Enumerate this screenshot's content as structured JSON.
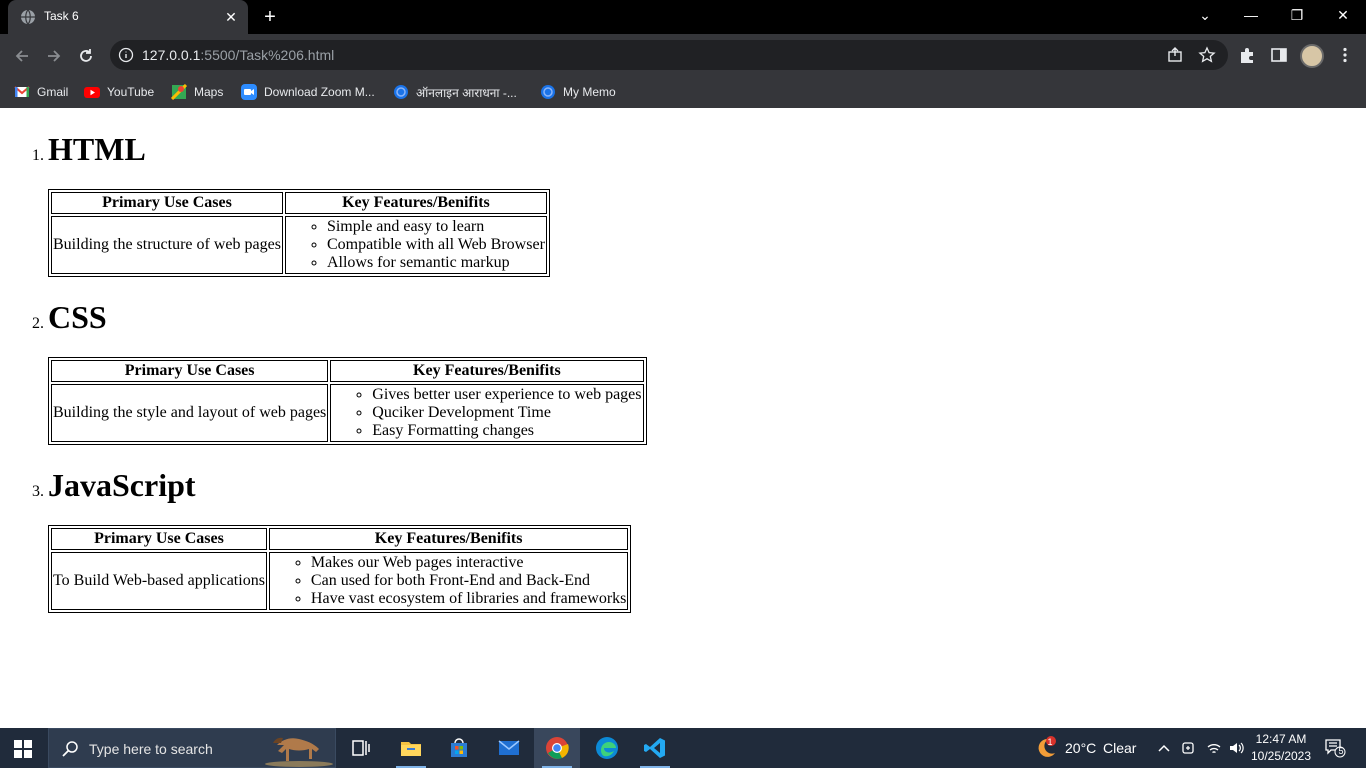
{
  "browser": {
    "tab_title": "Task 6",
    "url_host": "127.0.0.1",
    "url_rest": ":5500/Task%206.html",
    "bookmarks": [
      "Gmail",
      "YouTube",
      "Maps",
      "Download Zoom M...",
      "ऑनलाइन आराधना -...",
      "My Memo"
    ]
  },
  "page": {
    "header_use": "Primary Use Cases",
    "header_features": "Key Features/Benifits",
    "sections": [
      {
        "number": "1.",
        "name": "HTML",
        "use_case": "Building the structure of web pages",
        "features": [
          "Simple and easy to learn",
          "Compatible with all Web Browser",
          "Allows for semantic markup"
        ]
      },
      {
        "number": "2.",
        "name": "CSS",
        "use_case": "Building the style and layout of web pages",
        "features": [
          "Gives better user experience to web pages",
          "Quciker Development Time",
          "Easy Formatting changes"
        ]
      },
      {
        "number": "3.",
        "name": "JavaScript",
        "use_case": "To Build Web-based applications",
        "features": [
          "Makes our Web pages interactive",
          "Can used for both Front-End and Back-End",
          "Have vast ecosystem of libraries and frameworks"
        ]
      }
    ]
  },
  "taskbar": {
    "search_placeholder": "Type here to search",
    "weather_badge": "1",
    "weather_temp": "20°C",
    "weather_condition": "Clear",
    "time": "12:47 AM",
    "date": "10/25/2023",
    "notification_count": "5"
  },
  "icons": {
    "chrome-tab-favicon": "globe-icon",
    "back": "arrow-left-icon",
    "forward": "arrow-right-icon",
    "reload": "reload-icon",
    "site-info": "info-icon",
    "share": "share-icon",
    "bookmark": "star-icon",
    "extensions": "puzzle-icon",
    "side-panel": "side-panel-icon",
    "menu": "kebab-menu-icon"
  }
}
